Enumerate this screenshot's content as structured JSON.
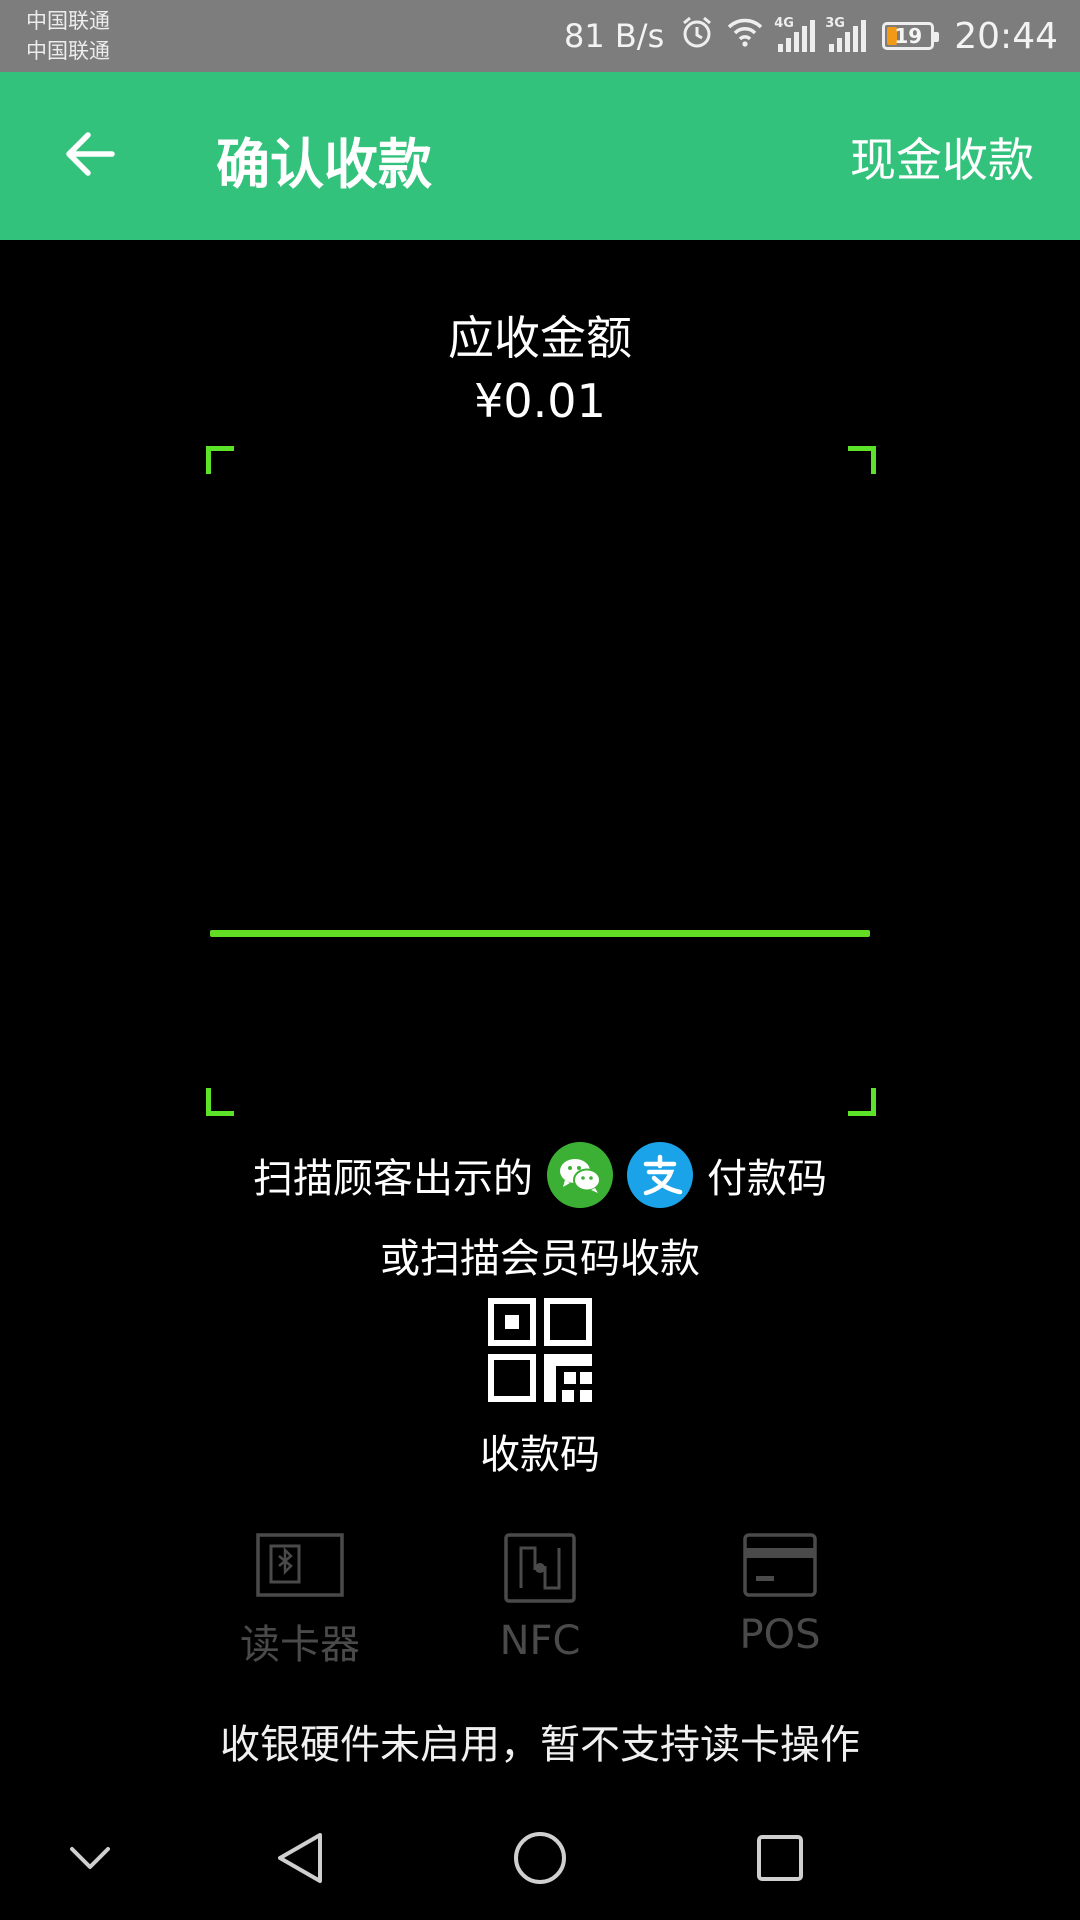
{
  "status_bar": {
    "carrier_1": "中国联通",
    "carrier_2": "中国联通",
    "net_speed": "81 B/s",
    "net_1": "4G",
    "net_2": "3G",
    "battery_level": "19",
    "time": "20:44"
  },
  "app_bar": {
    "title": "确认收款",
    "cash_label": "现金收款"
  },
  "amount": {
    "label": "应收金额",
    "value": "¥0.01"
  },
  "hint": {
    "line1_prefix": "扫描顾客出示的",
    "line1_suffix": "付款码",
    "line2": "或扫描会员码收款"
  },
  "qr_code": {
    "label": "收款码"
  },
  "hardware": {
    "card_reader": "读卡器",
    "nfc": "NFC",
    "pos": "POS"
  },
  "notice": "收银硬件未启用，暂不支持读卡操作",
  "colors": {
    "app_bar": "#33c27c",
    "scanner_accent": "#5de22a",
    "wechat": "#3cb035",
    "alipay": "#1aa3e8",
    "disabled_gray": "#4a4a4a"
  }
}
